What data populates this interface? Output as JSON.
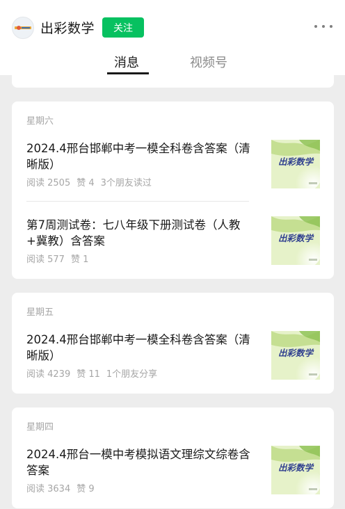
{
  "account": {
    "name": "出彩数学",
    "follow_label": "关注"
  },
  "tabs": [
    {
      "label": "消息",
      "active": true
    },
    {
      "label": "视频号",
      "active": false
    }
  ],
  "colors": {
    "accent": "#07c160",
    "background": "#ededed",
    "text": "#191919",
    "muted": "#a6a6a6"
  },
  "icons": {
    "avatar": "logo-avatar-icon",
    "more": "more-dots-icon",
    "thumbnail": "chucai-shuxue-thumbnail"
  },
  "groups": [
    {
      "day": "星期六",
      "items": [
        {
          "title": "2024.4邢台邯郸中考一模全科卷含答案（清晰版）",
          "reads": "阅读 2505",
          "likes": "赞 4",
          "social": "3个朋友读过"
        },
        {
          "title": "第7周测试卷：七八年级下册测试卷（人教+冀教）含答案",
          "reads": "阅读 577",
          "likes": "赞 1",
          "social": ""
        }
      ]
    },
    {
      "day": "星期五",
      "items": [
        {
          "title": "2024.4邢台邯郸中考一模全科卷含答案（清晰版）",
          "reads": "阅读 4239",
          "likes": "赞 11",
          "social": "1个朋友分享"
        }
      ]
    },
    {
      "day": "星期四",
      "items": [
        {
          "title": "2024.4邢台一模中考模拟语文理综文综卷含答案",
          "reads": "阅读 3634",
          "likes": "赞 9",
          "social": ""
        }
      ]
    }
  ],
  "thumbnail": {
    "text": "出彩数学"
  }
}
